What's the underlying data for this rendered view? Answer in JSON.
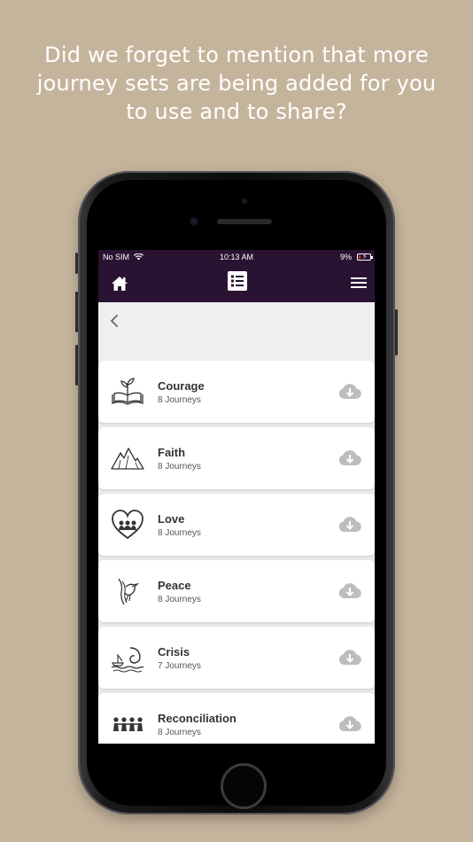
{
  "headline": "Did we forget to mention that more\njourney sets are being added for you\nto use and to share?",
  "status_bar": {
    "carrier": "No SIM",
    "time": "10:13 AM",
    "battery": "9%"
  },
  "navbar": {
    "left_icon": "home-icon",
    "center_icon": "list-icon",
    "right_icon": "hamburger-menu-icon"
  },
  "subheader": {
    "back_icon": "chevron-left-icon"
  },
  "journey_sets": [
    {
      "title": "Courage",
      "count": "8 Journeys",
      "icon": "open-book-sprout-icon",
      "action_icon": "cloud-download-icon"
    },
    {
      "title": "Faith",
      "count": "8 Journeys",
      "icon": "mountains-icon",
      "action_icon": "cloud-download-icon"
    },
    {
      "title": "Love",
      "count": "8 Journeys",
      "icon": "heart-people-icon",
      "action_icon": "cloud-download-icon"
    },
    {
      "title": "Peace",
      "count": "8 Journeys",
      "icon": "dove-icon",
      "action_icon": "cloud-download-icon"
    },
    {
      "title": "Crisis",
      "count": "7 Journeys",
      "icon": "boat-storm-icon",
      "action_icon": "cloud-download-icon"
    },
    {
      "title": "Reconciliation",
      "count": "8 Journeys",
      "icon": "people-holding-hands-icon",
      "action_icon": "cloud-download-icon"
    }
  ],
  "colors": {
    "background": "#c5b49c",
    "app_bar": "#2a1232",
    "download_icon": "#bdbdbd"
  }
}
